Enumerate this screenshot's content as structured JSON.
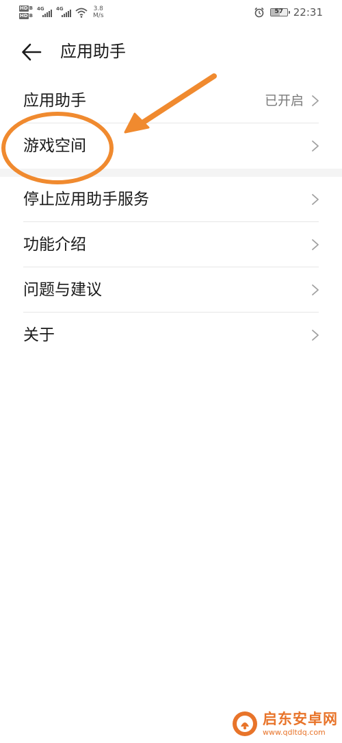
{
  "status_bar": {
    "hd_label": "HD",
    "hd_sub": "B",
    "network_type_1": "4G",
    "network_type_2": "4G",
    "speed_value": "3.8",
    "speed_unit": "M/s",
    "alarm_icon": "alarm-clock-icon",
    "battery_level": "57",
    "time": "22:31"
  },
  "header": {
    "back_icon": "arrow-left-icon",
    "title": "应用助手"
  },
  "section1": [
    {
      "label": "应用助手",
      "value": "已开启"
    },
    {
      "label": "游戏空间",
      "value": ""
    }
  ],
  "section2": [
    {
      "label": "停止应用助手服务"
    },
    {
      "label": "功能介绍"
    },
    {
      "label": "问题与建议"
    },
    {
      "label": "关于"
    }
  ],
  "watermark": {
    "title": "启东安卓网",
    "url": "www.qdltdq.com"
  },
  "colors": {
    "annotation": "#f08a2f",
    "text_primary": "#1a1a1a",
    "text_secondary": "#7a7a7a",
    "divider": "#e6e6e6",
    "chevron": "#a0a0a0"
  }
}
